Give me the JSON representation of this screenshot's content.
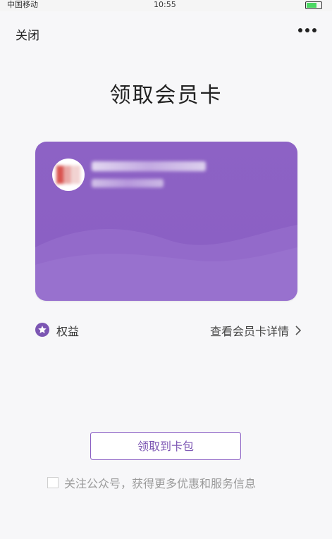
{
  "status_bar": {
    "carrier": "中国移动",
    "time": "10:55"
  },
  "nav": {
    "close_label": "关闭",
    "more_icon": "more-dots-icon"
  },
  "page": {
    "title": "领取会员卡"
  },
  "card": {
    "background_color": "#8a5fc3",
    "name_obscured": true,
    "subtitle_obscured": true
  },
  "benefits": {
    "label": "权益",
    "icon": "star-icon",
    "details_link": "查看会员卡详情"
  },
  "actions": {
    "receive_button": "领取到卡包",
    "follow_text": "关注公众号，获得更多优惠和服务信息",
    "follow_checked": false
  },
  "colors": {
    "accent": "#8a5fc3"
  }
}
